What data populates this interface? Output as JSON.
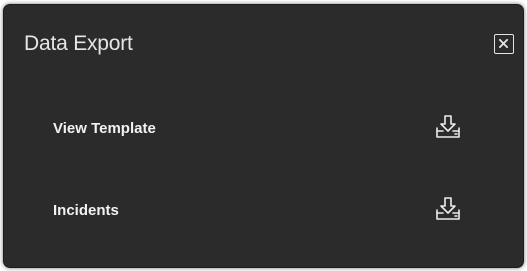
{
  "dialog": {
    "title": "Data Export",
    "close_icon": "close-icon",
    "items": [
      {
        "label": "View Template",
        "icon": "download-icon"
      },
      {
        "label": "Incidents",
        "icon": "download-icon"
      }
    ]
  },
  "colors": {
    "dialog_background": "#2b2b2b",
    "text": "#f2f2f2",
    "page_background": "#ffffff"
  }
}
